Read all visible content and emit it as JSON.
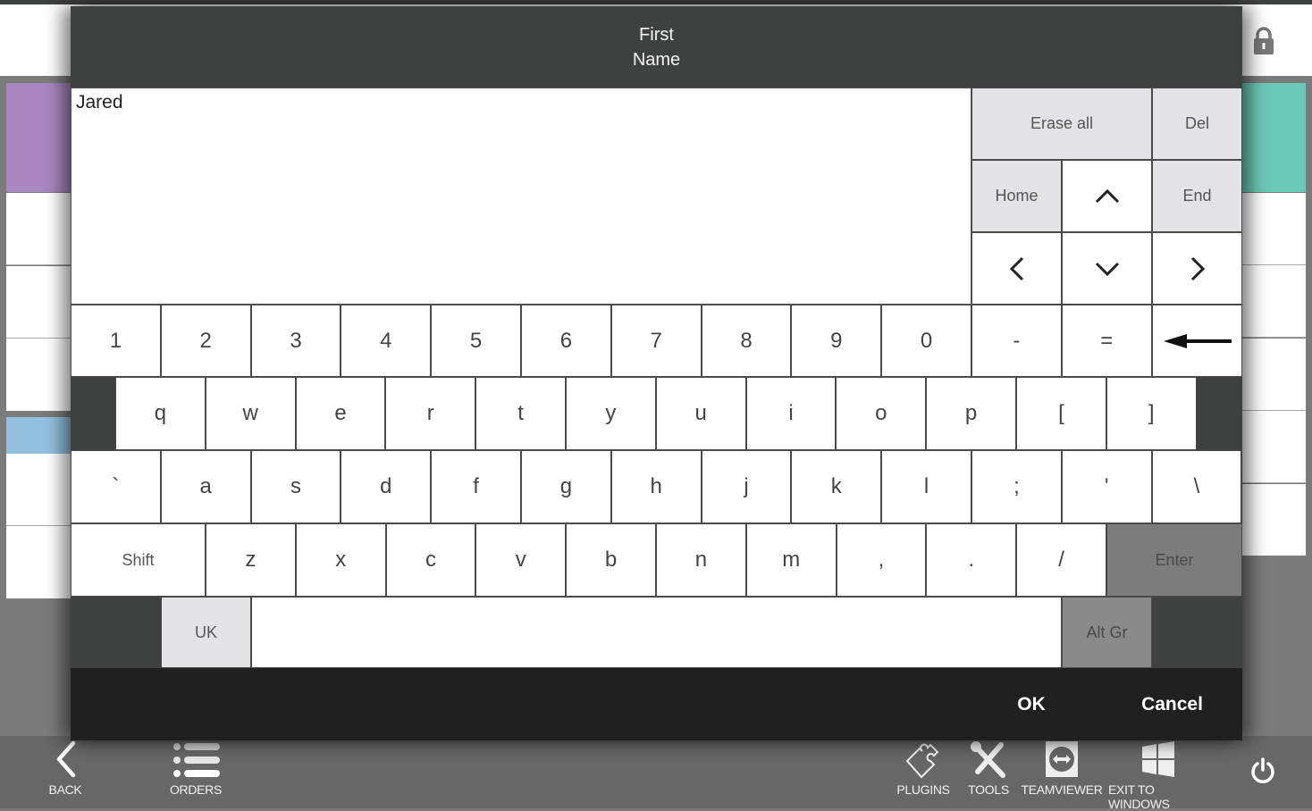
{
  "dialog": {
    "title_line1": "First",
    "title_line2": "Name",
    "input_value": "Jared",
    "ok_label": "OK",
    "cancel_label": "Cancel"
  },
  "edit_keys": {
    "erase_all": "Erase all",
    "del": "Del",
    "home": "Home",
    "end": "End"
  },
  "keyboard": {
    "row_numbers": [
      "1",
      "2",
      "3",
      "4",
      "5",
      "6",
      "7",
      "8",
      "9",
      "0",
      "-",
      "="
    ],
    "row_top": [
      "q",
      "w",
      "e",
      "r",
      "t",
      "y",
      "u",
      "i",
      "o",
      "p",
      "[",
      "]"
    ],
    "row_home": [
      "`",
      "a",
      "s",
      "d",
      "f",
      "g",
      "h",
      "j",
      "k",
      "l",
      ";",
      "'",
      "\\"
    ],
    "row_bottom": [
      "z",
      "x",
      "c",
      "v",
      "b",
      "n",
      "m",
      ",",
      ".",
      "/"
    ],
    "shift": "Shift",
    "enter": "Enter",
    "layout": "UK",
    "alt_gr": "Alt Gr"
  },
  "background": {
    "tile_colors": {
      "purple": "#a887c0",
      "teal": "#6cc9b7",
      "blue": "#92c0de"
    }
  },
  "taskbar": {
    "back": "BACK",
    "orders": "ORDERS",
    "plugins": "PLUGINS",
    "tools": "TOOLS",
    "teamviewer": "TEAMVIEWER",
    "exit_to_windows": "EXIT TO WINDOWS"
  }
}
